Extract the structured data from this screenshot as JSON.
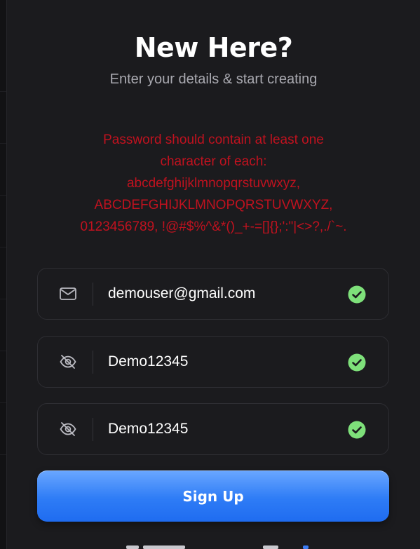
{
  "header": {
    "title": "New Here?",
    "subtitle": "Enter your details & start creating"
  },
  "error": {
    "lines": [
      "Password should contain at least one",
      "character of each:",
      "abcdefghijklmnopqrstuvwxyz,",
      "ABCDEFGHIJKLMNOPQRSTUVWXYZ,",
      "0123456789, !@#$%^&*()_+-=[]{};':\"|<>?,./`~."
    ],
    "color": "#c0121f"
  },
  "fields": {
    "email": {
      "value": "demouser@gmail.com",
      "icon": "mail-icon",
      "valid": true
    },
    "password": {
      "value": "Demo12345",
      "icon": "eye-slash-icon",
      "valid": true
    },
    "confirm_password": {
      "value": "Demo12345",
      "icon": "eye-slash-icon",
      "valid": true
    }
  },
  "actions": {
    "signup_label": "Sign Up"
  },
  "colors": {
    "accent": "#2e7cf6",
    "valid": "#7ee07a",
    "error": "#c0121f"
  }
}
